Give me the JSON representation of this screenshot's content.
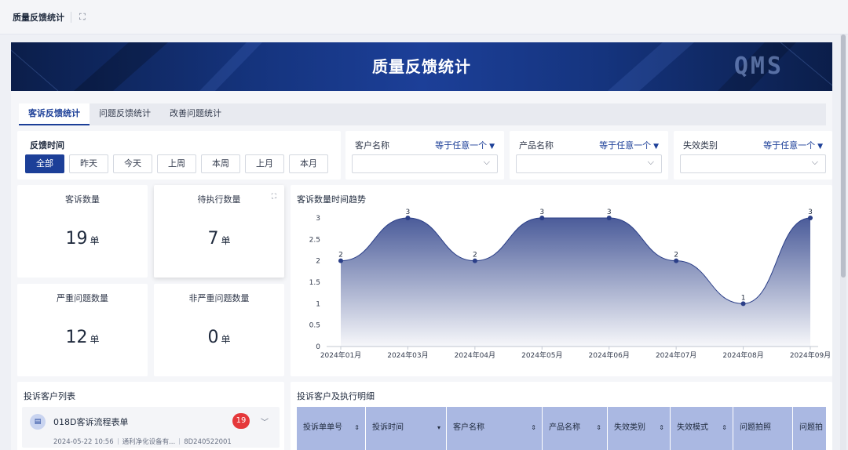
{
  "header": {
    "title": "质量反馈统计",
    "expand_icon": "expand-icon"
  },
  "banner": {
    "title": "质量反馈统计",
    "logo": "QMS"
  },
  "tabs": [
    {
      "label": "客诉反馈统计",
      "active": true
    },
    {
      "label": "问题反馈统计",
      "active": false
    },
    {
      "label": "改善问题统计",
      "active": false
    }
  ],
  "feedback_time": {
    "label": "反馈时间",
    "buttons": [
      {
        "label": "全部",
        "active": true
      },
      {
        "label": "昨天",
        "active": false
      },
      {
        "label": "今天",
        "active": false
      },
      {
        "label": "上周",
        "active": false
      },
      {
        "label": "本周",
        "active": false
      },
      {
        "label": "上月",
        "active": false
      },
      {
        "label": "本月",
        "active": false
      }
    ]
  },
  "filters": [
    {
      "label": "客户名称",
      "operator": "等于任意一个"
    },
    {
      "label": "产品名称",
      "operator": "等于任意一个"
    },
    {
      "label": "失效类别",
      "operator": "等于任意一个"
    }
  ],
  "metrics": [
    {
      "label": "客诉数量",
      "value": "19",
      "unit": "单"
    },
    {
      "label": "待执行数量",
      "value": "7",
      "unit": "单"
    },
    {
      "label": "严重问题数量",
      "value": "12",
      "unit": "单"
    },
    {
      "label": "非严重问题数量",
      "value": "0",
      "unit": "单"
    }
  ],
  "chart_title": "客诉数量时间趋势",
  "chart_data": {
    "type": "area",
    "title": "客诉数量时间趋势",
    "categories": [
      "2024年01月",
      "2024年03月",
      "2024年04月",
      "2024年05月",
      "2024年06月",
      "2024年07月",
      "2024年08月",
      "2024年09月"
    ],
    "series": [
      {
        "values": [
          2,
          3,
          2,
          3,
          3,
          2,
          1,
          3
        ]
      }
    ],
    "ylim": [
      0,
      3
    ],
    "yticks": [
      0,
      0.5,
      1,
      1.5,
      2,
      2.5,
      3
    ],
    "grid": false,
    "color": "#2b3f88",
    "data_labels": true
  },
  "customer_list": {
    "title": "投诉客户列表",
    "items": [
      {
        "title": "018D客诉流程表单",
        "badge": "19",
        "date": "2024-05-22 10:56",
        "company": "通利净化设备有...",
        "code": "8D240522001"
      }
    ]
  },
  "detail": {
    "title": "投诉客户及执行明细",
    "columns": [
      {
        "label": "投诉单单号",
        "sort": "⇕"
      },
      {
        "label": "投诉时间",
        "sort": "▾"
      },
      {
        "label": "客户名称",
        "sort": "⇕"
      },
      {
        "label": "产品名称",
        "sort": "⇕"
      },
      {
        "label": "失效类别",
        "sort": "⇕"
      },
      {
        "label": "失效模式",
        "sort": "⇕"
      },
      {
        "label": "问题拍照",
        "sort": ""
      },
      {
        "label": "问题拍",
        "sort": ""
      }
    ]
  },
  "colors": {
    "primary": "#1c3f98",
    "badge": "#e5383b",
    "table_header": "#aab8e2"
  }
}
